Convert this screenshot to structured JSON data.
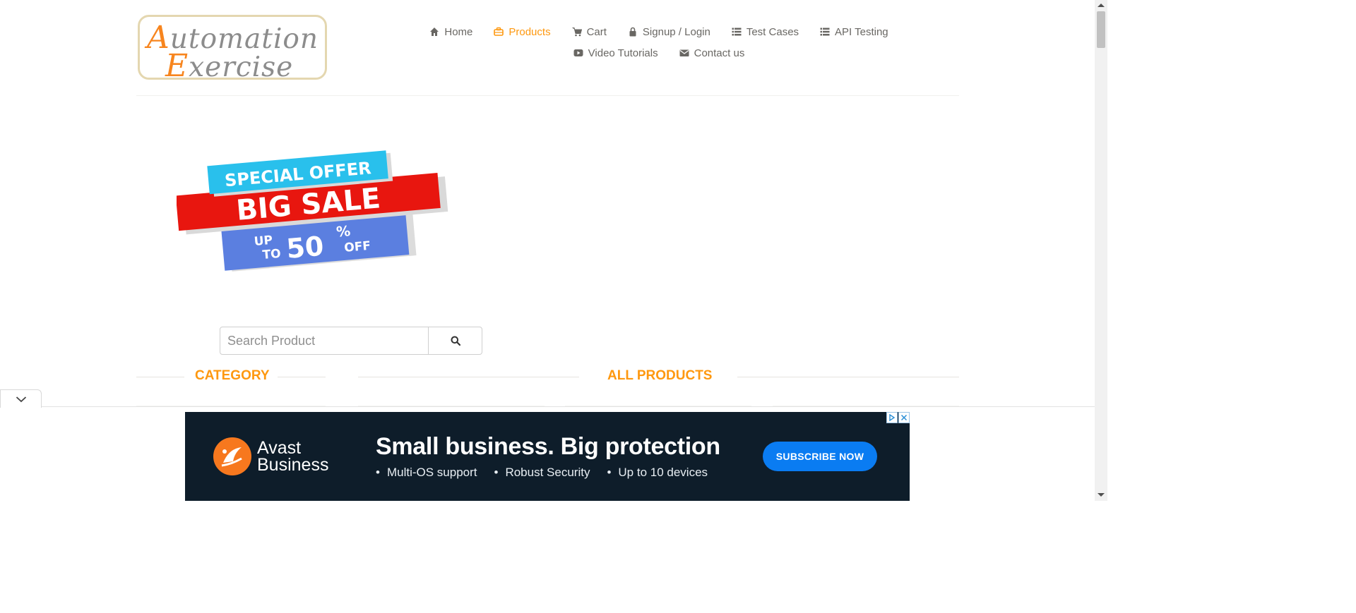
{
  "logo": {
    "line1_cap": "A",
    "line1_rest": "utomation",
    "line2_cap": "E",
    "line2_rest": "xercise"
  },
  "nav": {
    "items": [
      {
        "label": "Home",
        "icon": "home-icon"
      },
      {
        "label": "Products",
        "icon": "briefcase-icon",
        "active": true
      },
      {
        "label": "Cart",
        "icon": "cart-icon"
      },
      {
        "label": "Signup / Login",
        "icon": "lock-icon"
      },
      {
        "label": "Test Cases",
        "icon": "list-icon"
      },
      {
        "label": "API Testing",
        "icon": "list-icon"
      },
      {
        "label": "Video Tutorials",
        "icon": "youtube-play-icon"
      },
      {
        "label": "Contact us",
        "icon": "envelope-icon"
      }
    ]
  },
  "sale_banner": {
    "special_offer": "SPECIAL OFFER",
    "big_sale": "BIG SALE",
    "up": "UP",
    "to": "TO",
    "percent": "50",
    "percent_sign": "%",
    "off": "OFF"
  },
  "search": {
    "placeholder": "Search Product",
    "value": ""
  },
  "sections": {
    "category": "CATEGORY",
    "all_products": "ALL PRODUCTS"
  },
  "ad": {
    "brand_line1": "Avast",
    "brand_line2": "Business",
    "headline": "Small business. Big protection",
    "bullets": [
      "Multi-OS support",
      "Robust Security",
      "Up to 10 devices"
    ],
    "cta": "SUBSCRIBE NOW"
  },
  "colors": {
    "accent": "#fe980f",
    "text": "#696763",
    "ad_bg": "#0e1d2a",
    "ad_cta": "#0a7cf2",
    "avast_orange": "#f7781e"
  }
}
